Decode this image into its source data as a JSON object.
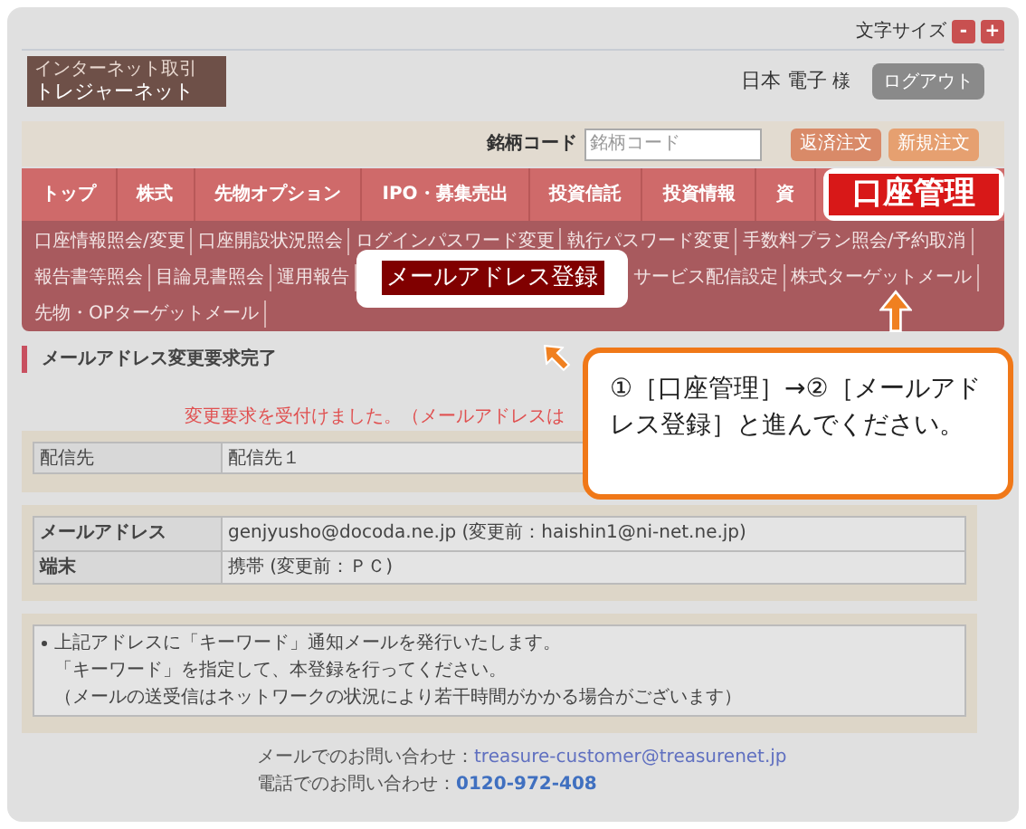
{
  "header": {
    "text_size_label": "文字サイズ",
    "text_size_buttons": [
      "-",
      "+"
    ],
    "logo": {
      "tagline": "インターネット取引",
      "name": "トレジャーネット"
    },
    "user_name": "日本 電子",
    "honorific": "様",
    "logout": "ログアウト"
  },
  "search": {
    "label": "銘柄コード",
    "placeholder": "銘柄コード",
    "buttons": [
      "返済注文",
      "新規注文"
    ]
  },
  "nav": [
    {
      "label": "トップ",
      "kind": "tab"
    },
    {
      "label": "株式",
      "kind": "tab"
    },
    {
      "label": "先物オプション",
      "kind": "tab"
    },
    {
      "label": "IPO・募集売出",
      "kind": "tab"
    },
    {
      "label": "投資信託",
      "kind": "tab"
    },
    {
      "label": "投資情報",
      "kind": "tab"
    },
    {
      "label": "資",
      "kind": "tab"
    },
    {
      "label": "口座管理",
      "kind": "highlight"
    }
  ],
  "submenu": [
    [
      {
        "label": "口座情報照会/変更",
        "kind": "link"
      },
      {
        "label": "口座開設状況照会",
        "kind": "link"
      },
      {
        "label": "ログインパスワード変更",
        "kind": "link"
      },
      {
        "label": "執行パスワード変更",
        "kind": "link"
      },
      {
        "label": "手数料プラン照会/予約取消",
        "kind": "link"
      }
    ],
    [
      {
        "label": "報告書等照会",
        "kind": "link"
      },
      {
        "label": "目論見書照会",
        "kind": "link"
      },
      {
        "label": "運用報告",
        "kind": "link"
      },
      {
        "label": "メールアドレス登録",
        "kind": "highlight"
      },
      {
        "label": "サービス配信設定",
        "kind": "link"
      },
      {
        "label": "株式ターゲットメール",
        "kind": "link"
      }
    ],
    [
      {
        "label": "先物・OPターゲットメール",
        "kind": "link"
      }
    ]
  ],
  "page_title": "メールアドレス変更要求完了",
  "message": "変更要求を受付けました。（メールアドレスは",
  "delivery_table": [
    {
      "label": "配信先",
      "value": "配信先１"
    }
  ],
  "address_table": [
    {
      "label": "メールアドレス",
      "value": "genjyusho@docoda.ne.jp (変更前：haishin1@ni-net.ne.jp)"
    },
    {
      "label": "端末",
      "value": "携帯 (変更前：ＰＣ)"
    }
  ],
  "notes": [
    "上記アドレスに「キーワード」通知メールを発行いたします。",
    "「キーワード」を指定して、本登録を行ってください。",
    "（メールの送受信はネットワークの状況により若干時間がかかる場合がございます）"
  ],
  "footer": [
    {
      "label": "メールでのお問い合わせ：",
      "value": "treasure-customer@treasurenet.jp",
      "kind": "email"
    },
    {
      "label": "電話でのお問い合わせ：",
      "value": "0120-972-408",
      "kind": "phone"
    }
  ],
  "callout": "①［口座管理］→②［メールアドレス登録］と進んでください。"
}
